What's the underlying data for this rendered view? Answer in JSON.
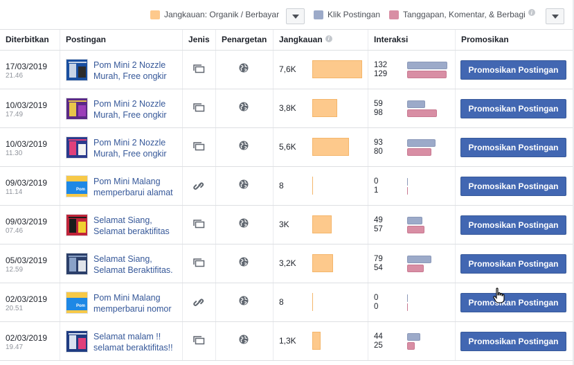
{
  "legend": {
    "items": [
      {
        "label": "Jangkauan: Organik / Berbayar",
        "color": "#fdc98c"
      },
      {
        "label": "Klik Postingan",
        "color": "#9caac9"
      },
      {
        "label": "Tanggapan, Komentar, & Berbagi",
        "color": "#d88ea4"
      }
    ],
    "info_glyph": "i"
  },
  "columns": {
    "published": "Diterbitkan",
    "post": "Postingan",
    "type": "Jenis",
    "targeting": "Penargetan",
    "reach": "Jangkauan",
    "interactions": "Interaksi",
    "promote": "Promosikan"
  },
  "rows": [
    {
      "date": "17/03/2019",
      "time": "21.46",
      "title": "Pom Mini 2 Nozzle Murah, Free ongkir",
      "type": "photo",
      "reach": "7,6K",
      "reach_value": 7600,
      "clicks": "132",
      "reactions": "129",
      "thumb": "machine-blue",
      "button": "Promosikan Postingan"
    },
    {
      "date": "10/03/2019",
      "time": "17.49",
      "title": "Pom Mini 2 Nozzle Murah, Free ongkir",
      "type": "photo",
      "reach": "3,8K",
      "reach_value": 3800,
      "clicks": "59",
      "reactions": "98",
      "thumb": "purple-flyer",
      "button": "Promosikan Postingan"
    },
    {
      "date": "10/03/2019",
      "time": "11.30",
      "title": "Pom Mini 2 Nozzle Murah, Free ongkir",
      "type": "photo",
      "reach": "5,6K",
      "reach_value": 5600,
      "clicks": "93",
      "reactions": "80",
      "thumb": "pink-flyer",
      "button": "Promosikan Postingan"
    },
    {
      "date": "09/03/2019",
      "time": "11.14",
      "title": "Pom Mini Malang memperbarui alamat",
      "type": "link",
      "reach": "8",
      "reach_value": 8,
      "clicks": "0",
      "reactions": "1",
      "thumb": "link-preview",
      "button": "Promosikan Postingan"
    },
    {
      "date": "09/03/2019",
      "time": "07.46",
      "title": "Selamat Siang, Selamat beraktifitas",
      "type": "photo",
      "reach": "3K",
      "reach_value": 3000,
      "clicks": "49",
      "reactions": "57",
      "thumb": "red-flyer",
      "button": "Promosikan Postingan"
    },
    {
      "date": "05/03/2019",
      "time": "12.59",
      "title": "Selamat Siang, Selamat Beraktifitas.",
      "type": "photo",
      "reach": "3,2K",
      "reach_value": 3200,
      "clicks": "79",
      "reactions": "54",
      "thumb": "machine-dark",
      "button": "Promosikan Postingan"
    },
    {
      "date": "02/03/2019",
      "time": "20.51",
      "title": "Pom Mini Malang memperbarui nomor",
      "type": "link",
      "reach": "8",
      "reach_value": 8,
      "clicks": "0",
      "reactions": "0",
      "thumb": "link-preview",
      "button": "Promosikan Postingan"
    },
    {
      "date": "02/03/2019",
      "time": "19.47",
      "title": "Selamat malam !! selamat beraktifitas!!",
      "type": "photo",
      "reach": "1,3K",
      "reach_value": 1300,
      "clicks": "44",
      "reactions": "25",
      "thumb": "blue-flyer",
      "button": "Promosikan Postingan"
    }
  ]
}
